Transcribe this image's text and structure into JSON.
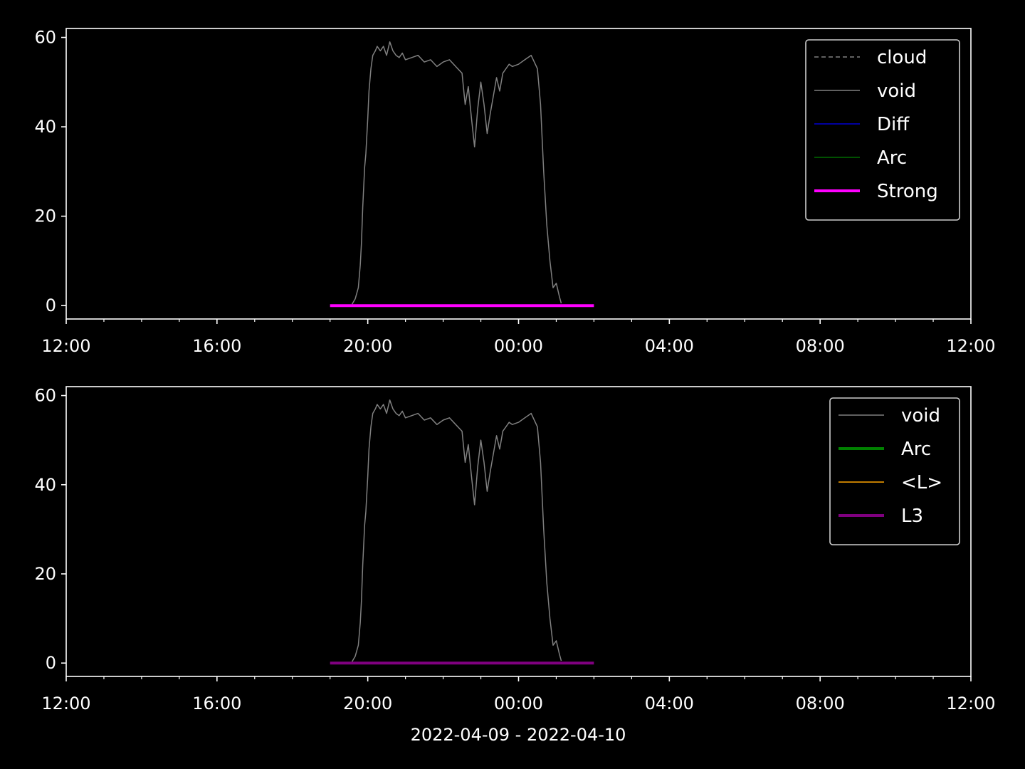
{
  "figure": {
    "background": "#000000",
    "xlabel": "2022-04-09 - 2022-04-10"
  },
  "chart_data": [
    {
      "type": "line",
      "x_unit": "time",
      "xlim": [
        "2022-04-09 12:00",
        "2022-04-10 12:00"
      ],
      "xticks": [
        "12:00",
        "16:00",
        "20:00",
        "00:00",
        "04:00",
        "08:00",
        "12:00"
      ],
      "ylim": [
        -3,
        62
      ],
      "yticks": [
        "0",
        "20",
        "40",
        "60"
      ],
      "grid": false,
      "legend_position": "top-right",
      "series": [
        {
          "name": "cloud",
          "color": "#808080",
          "style": "dashed",
          "width": 1.5,
          "x": [],
          "y": []
        },
        {
          "name": "void",
          "color": "#808080",
          "style": "solid",
          "width": 1.5,
          "x": [
            "2022-04-09 19:35",
            "2022-04-09 19:40",
            "2022-04-09 19:45",
            "2022-04-09 19:48",
            "2022-04-09 19:50",
            "2022-04-09 19:52",
            "2022-04-09 19:55",
            "2022-04-09 19:57",
            "2022-04-09 20:00",
            "2022-04-09 20:02",
            "2022-04-09 20:05",
            "2022-04-09 20:08",
            "2022-04-09 20:12",
            "2022-04-09 20:15",
            "2022-04-09 20:20",
            "2022-04-09 20:25",
            "2022-04-09 20:30",
            "2022-04-09 20:35",
            "2022-04-09 20:40",
            "2022-04-09 20:45",
            "2022-04-09 20:50",
            "2022-04-09 20:55",
            "2022-04-09 21:00",
            "2022-04-09 21:10",
            "2022-04-09 21:20",
            "2022-04-09 21:30",
            "2022-04-09 21:40",
            "2022-04-09 21:50",
            "2022-04-09 22:00",
            "2022-04-09 22:10",
            "2022-04-09 22:20",
            "2022-04-09 22:30",
            "2022-04-09 22:35",
            "2022-04-09 22:40",
            "2022-04-09 22:45",
            "2022-04-09 22:50",
            "2022-04-09 22:55",
            "2022-04-09 23:00",
            "2022-04-09 23:05",
            "2022-04-09 23:10",
            "2022-04-09 23:15",
            "2022-04-09 23:20",
            "2022-04-09 23:25",
            "2022-04-09 23:30",
            "2022-04-09 23:35",
            "2022-04-09 23:40",
            "2022-04-09 23:45",
            "2022-04-09 23:50",
            "2022-04-10 00:00",
            "2022-04-10 00:10",
            "2022-04-10 00:20",
            "2022-04-10 00:25",
            "2022-04-10 00:30",
            "2022-04-10 00:35",
            "2022-04-10 00:40",
            "2022-04-10 00:45",
            "2022-04-10 00:50",
            "2022-04-10 00:55",
            "2022-04-10 01:00",
            "2022-04-10 01:05",
            "2022-04-10 01:08"
          ],
          "y": [
            0.3,
            1.5,
            4,
            9,
            14,
            22,
            31,
            34,
            42,
            48,
            53,
            56,
            57,
            58,
            57,
            58,
            56,
            59,
            57,
            56,
            55.5,
            56.5,
            55,
            55.5,
            56,
            54.5,
            55,
            53.5,
            54.5,
            55,
            53.5,
            52,
            45,
            49,
            42,
            35.5,
            44,
            50,
            45,
            38.5,
            43,
            47,
            51,
            48,
            52,
            53,
            54,
            53.5,
            54,
            55,
            56,
            54.5,
            53,
            45,
            30,
            18,
            10,
            4,
            5,
            2,
            0.5
          ]
        },
        {
          "name": "Diff",
          "color": "#0000ff",
          "style": "solid",
          "width": 1.2,
          "x": [],
          "y": []
        },
        {
          "name": "Arc",
          "color": "#008000",
          "style": "solid",
          "width": 1.2,
          "x": [],
          "y": []
        },
        {
          "name": "Strong",
          "color": "#ff00ff",
          "style": "solid",
          "width": 4,
          "x": [
            "2022-04-09 19:00",
            "2022-04-10 02:00"
          ],
          "y": [
            0,
            0
          ]
        }
      ]
    },
    {
      "type": "line",
      "x_unit": "time",
      "xlim": [
        "2022-04-09 12:00",
        "2022-04-10 12:00"
      ],
      "xticks": [
        "12:00",
        "16:00",
        "20:00",
        "00:00",
        "04:00",
        "08:00",
        "12:00"
      ],
      "ylim": [
        -3,
        62
      ],
      "yticks": [
        "0",
        "20",
        "40",
        "60"
      ],
      "grid": false,
      "legend_position": "top-right",
      "series": [
        {
          "name": "void",
          "color": "#808080",
          "style": "solid",
          "width": 1.5,
          "same_as": "void"
        },
        {
          "name": "Arc",
          "color": "#008000",
          "style": "solid",
          "width": 4,
          "x": [],
          "y": []
        },
        {
          "name": "<L>",
          "color": "#ffa500",
          "style": "solid",
          "width": 1.5,
          "x": [],
          "y": []
        },
        {
          "name": "L3",
          "color": "#800080",
          "style": "solid",
          "width": 4,
          "x": [
            "2022-04-09 19:00",
            "2022-04-10 02:00"
          ],
          "y": [
            0,
            0
          ]
        }
      ]
    }
  ]
}
